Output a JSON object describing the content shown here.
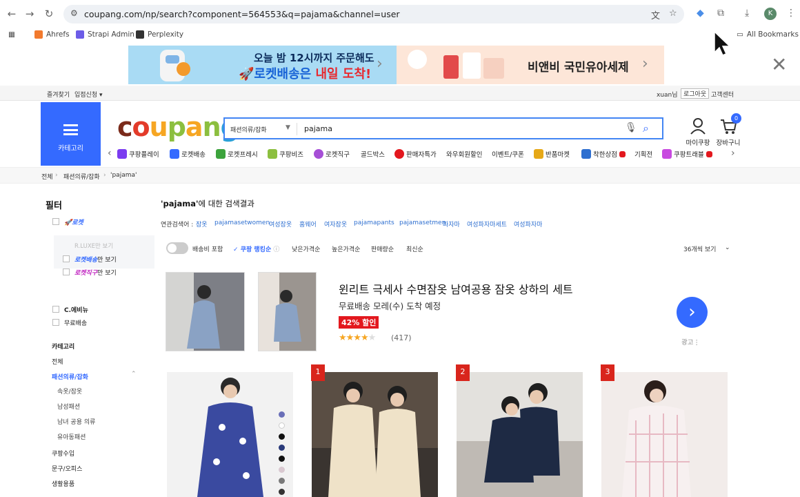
{
  "browser": {
    "url": "coupang.com/np/search?component=564553&q=pajama&channel=user",
    "profile_initial": "K",
    "bookmarks": [
      {
        "label": "Ahrefs",
        "color": "#f27a2e"
      },
      {
        "label": "Strapi Admin",
        "color": "#6c5ce7"
      },
      {
        "label": "Perplexity",
        "color": "#333333"
      }
    ],
    "all_bookmarks": "All Bookmarks"
  },
  "banner": {
    "left_line1": "오늘 밤 12시까지 주문해도",
    "left_line2a": "로켓배송은 ",
    "left_line2b": "내일 도착!",
    "right_text": "비앤비 국민유아세제"
  },
  "util": {
    "favorites": "즐겨찾기",
    "seller": "입점신청 ▾",
    "user": "xuan님",
    "logout": "로그아웃",
    "cs": "고객센터"
  },
  "header": {
    "category_label": "카테고리",
    "search_category": "패션의류/잡화",
    "search_query": "pajama",
    "my_coupang": "마이쿠팡",
    "cart": "장바구니",
    "cart_count": "0",
    "shortcuts": [
      {
        "label": "쿠팡플레이",
        "color": "#7b3cf0"
      },
      {
        "label": "로켓배송",
        "color": "#346aff"
      },
      {
        "label": "로켓프레시",
        "color": "#3ca33c"
      },
      {
        "label": "쿠팡비즈",
        "color": "#8cbf3f"
      },
      {
        "label": "로켓직구",
        "color": "#a64fd6"
      },
      {
        "label": "골드박스",
        "color": "#ffffff"
      },
      {
        "label": "판매자특가",
        "color": "#e3181e"
      },
      {
        "label": "와우회원할인",
        "color": "#ffffff"
      },
      {
        "label": "이벤트/쿠폰",
        "color": "#ffffff"
      },
      {
        "label": "반품마켓",
        "color": "#e6a817"
      },
      {
        "label": "착한상점",
        "color": "#2e6fd0"
      },
      {
        "label": "기획전",
        "color": "#ffffff"
      },
      {
        "label": "쿠팡트래블",
        "color": "#c84ae0"
      }
    ]
  },
  "breadcrumb": [
    "전체",
    "패션의류/잡화",
    "'pajama'"
  ],
  "sidebar": {
    "title": "필터",
    "rocket": "로켓",
    "rocket_wow": "R.LUXE만 보기",
    "rocket_delivery_a": "로켓배송",
    "rocket_delivery_b": "만 보기",
    "rocket_direct_a": "로켓직구",
    "rocket_direct_b": "만 보기",
    "cevernu": "C.에비뉴",
    "free_ship": "무료배송",
    "category_title": "카테고리",
    "categories": [
      {
        "label": "전체",
        "active": false
      },
      {
        "label": "패션의류/잡화",
        "active": true
      },
      {
        "label": "속옷/잠옷",
        "active": false,
        "sub": true
      },
      {
        "label": "남성패션",
        "active": false,
        "sub": true
      },
      {
        "label": "남녀 공용 의류",
        "active": false,
        "sub": true
      },
      {
        "label": "유아동패션",
        "active": false,
        "sub": true
      },
      {
        "label": "쿠팡수입",
        "active": false
      },
      {
        "label": "문구/오피스",
        "active": false
      },
      {
        "label": "생활용품",
        "active": false
      }
    ]
  },
  "results": {
    "title_query": "'pajama'",
    "title_suffix": "에 대한 검색결과",
    "related_label": "연관검색어 :",
    "related": [
      "잠옷",
      "pajamasetwomen",
      "여성잠옷",
      "홈웨어",
      "여자잠옷",
      "pajamapants",
      "pajamasetmen",
      "파자마",
      "여성파자마세트",
      "여성파자마"
    ],
    "sort": {
      "shipping_incl": "배송비 포함",
      "ranking": "쿠팡 랭킹순",
      "low_price": "낮은가격순",
      "high_price": "높은가격순",
      "sales": "판매량순",
      "newest": "최신순",
      "per_page": "36개씩 보기"
    }
  },
  "ad": {
    "title": "윈리트 극세사 수면잠옷 남여공용 잠옷 상하의 세트",
    "shipping": "무료배송  모레(수) 도착 예정",
    "discount": "42% 할인",
    "rating": 4.5,
    "reviews": "(417)",
    "label": "광고"
  },
  "products": [
    {
      "rank": "",
      "bg": "#f0f0f0"
    },
    {
      "rank": "1",
      "bg": "#e9e2d6"
    },
    {
      "rank": "2",
      "bg": "#dcdcdc"
    },
    {
      "rank": "3",
      "bg": "#efe9e6"
    }
  ],
  "swatches": [
    "#6a6fb8",
    "#ffffff",
    "#111111",
    "#2a3a7a",
    "#111111",
    "#d9c8d0",
    "#7a7a7a",
    "#333333"
  ]
}
